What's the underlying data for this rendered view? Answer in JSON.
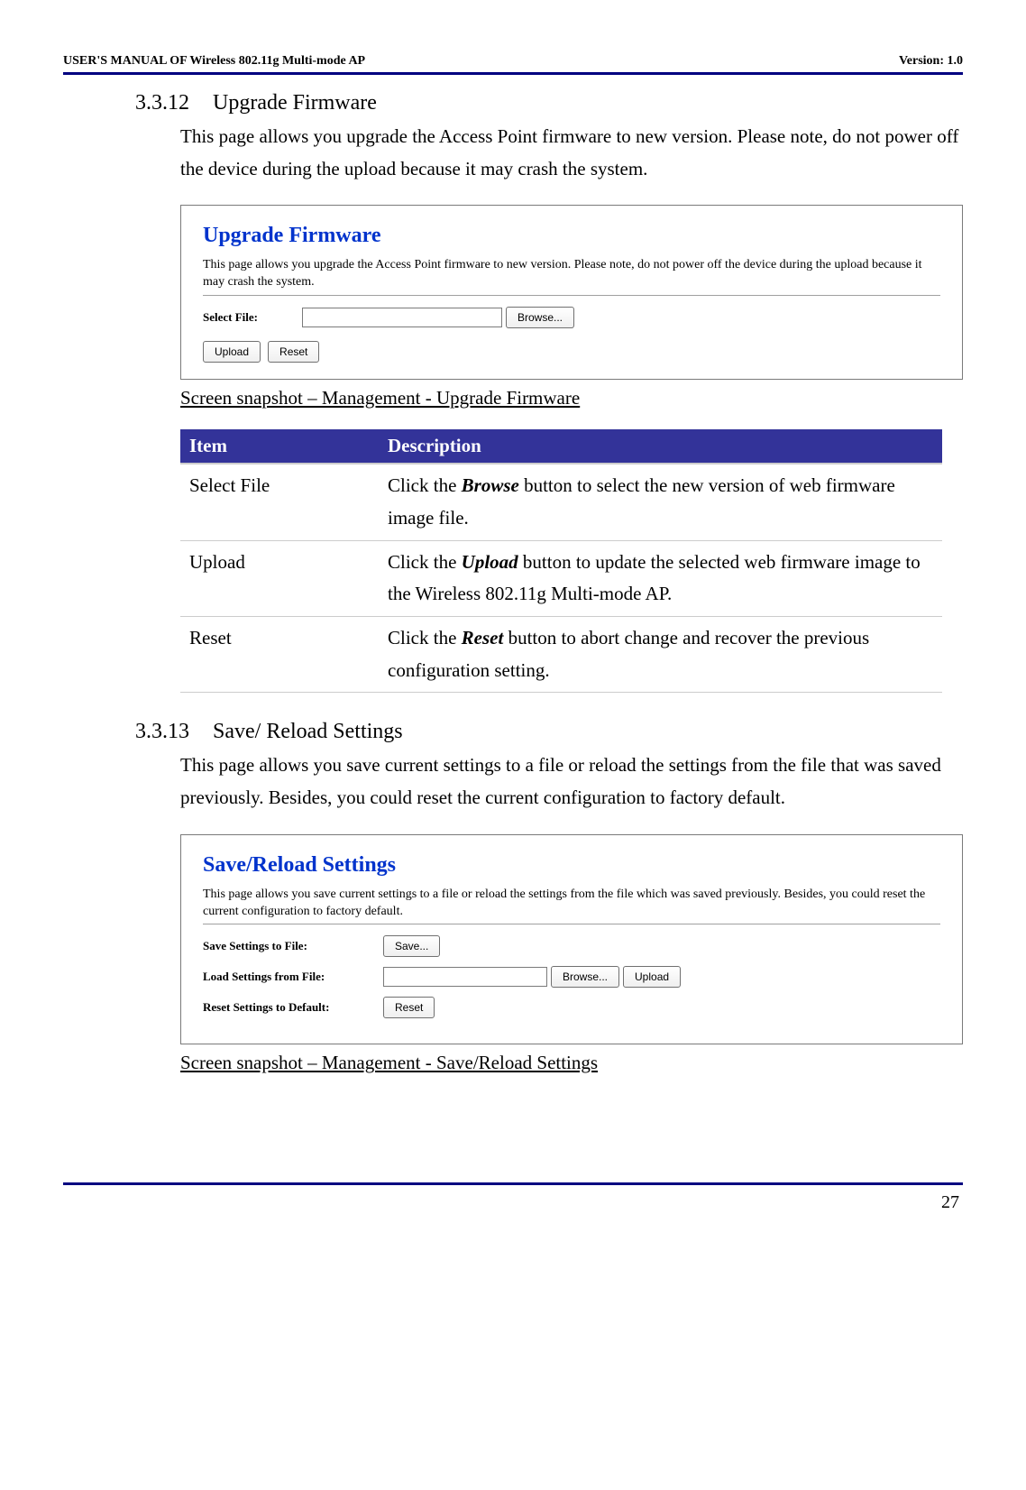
{
  "header": {
    "left": "USER'S MANUAL OF Wireless 802.11g Multi-mode AP",
    "right": "Version: 1.0"
  },
  "section1": {
    "num": "3.3.12",
    "title": "Upgrade Firmware",
    "body": "This page allows you upgrade the Access Point firmware to new version. Please note, do not power off the device during the upload because it may crash the system."
  },
  "screenshot1": {
    "title": "Upgrade Firmware",
    "desc": "This page allows you upgrade the Access Point firmware to new version. Please note, do not power off the device during the upload because it may crash the system.",
    "select_label": "Select File:",
    "browse_btn": "Browse...",
    "upload_btn": "Upload",
    "reset_btn": "Reset"
  },
  "caption1": "Screen snapshot – Management - Upgrade Firmware",
  "table1": {
    "head_item": "Item",
    "head_desc": "Description",
    "rows": [
      {
        "item": "Select File",
        "d1": "Click the ",
        "d2": "Browse",
        "d3": " button to select the new version of web firmware image file."
      },
      {
        "item": "Upload",
        "d1": "Click the ",
        "d2": "Upload",
        "d3": " button to update the selected web firmware image to the Wireless 802.11g Multi-mode AP."
      },
      {
        "item": "Reset",
        "d1": "Click the ",
        "d2": "Reset",
        "d3": " button to abort change and recover the previous configuration setting."
      }
    ]
  },
  "section2": {
    "num": "3.3.13",
    "title": "Save/ Reload Settings",
    "body": "This page allows you save current settings to a file or reload the settings from the file that was saved previously. Besides, you could reset the current configuration to factory default."
  },
  "screenshot2": {
    "title": "Save/Reload Settings",
    "desc": "This page allows you save current settings to a file or reload the settings from the file which was saved previously. Besides, you could reset the current configuration to factory default.",
    "save_label": "Save Settings to File:",
    "save_btn": "Save...",
    "load_label": "Load Settings from File:",
    "browse_btn": "Browse...",
    "upload_btn": "Upload",
    "reset_label": "Reset Settings to Default:",
    "reset_btn": "Reset"
  },
  "caption2": "Screen snapshot – Management - Save/Reload Settings",
  "page_number": "27"
}
